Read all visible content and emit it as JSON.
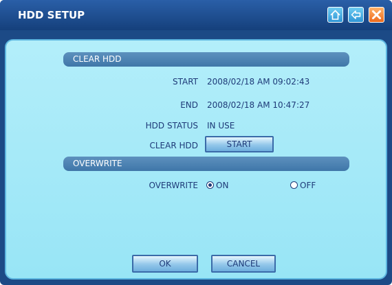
{
  "window": {
    "title": "HDD SETUP",
    "icons": [
      "home-icon",
      "back-arrow-icon",
      "close-icon"
    ]
  },
  "clear_hdd": {
    "section_title": "CLEAR HDD",
    "start_label": "START",
    "start_value": "2008/02/18 AM 09:02:43",
    "end_label": "END",
    "end_value": "2008/02/18 AM 10:47:27",
    "status_label": "HDD STATUS",
    "status_value": "IN USE",
    "clear_label": "CLEAR HDD",
    "clear_button": "START"
  },
  "overwrite": {
    "section_title": "OVERWRITE",
    "label": "OVERWRITE",
    "options": [
      {
        "label": "ON",
        "selected": true
      },
      {
        "label": "OFF",
        "selected": false
      }
    ]
  },
  "footer": {
    "ok_label": "OK",
    "cancel_label": "CANCEL"
  },
  "colors": {
    "titlebar": "#1c4a86",
    "panel": "#a8ebf8",
    "section_bar": "#4a82b3",
    "text": "#1e3a78"
  }
}
